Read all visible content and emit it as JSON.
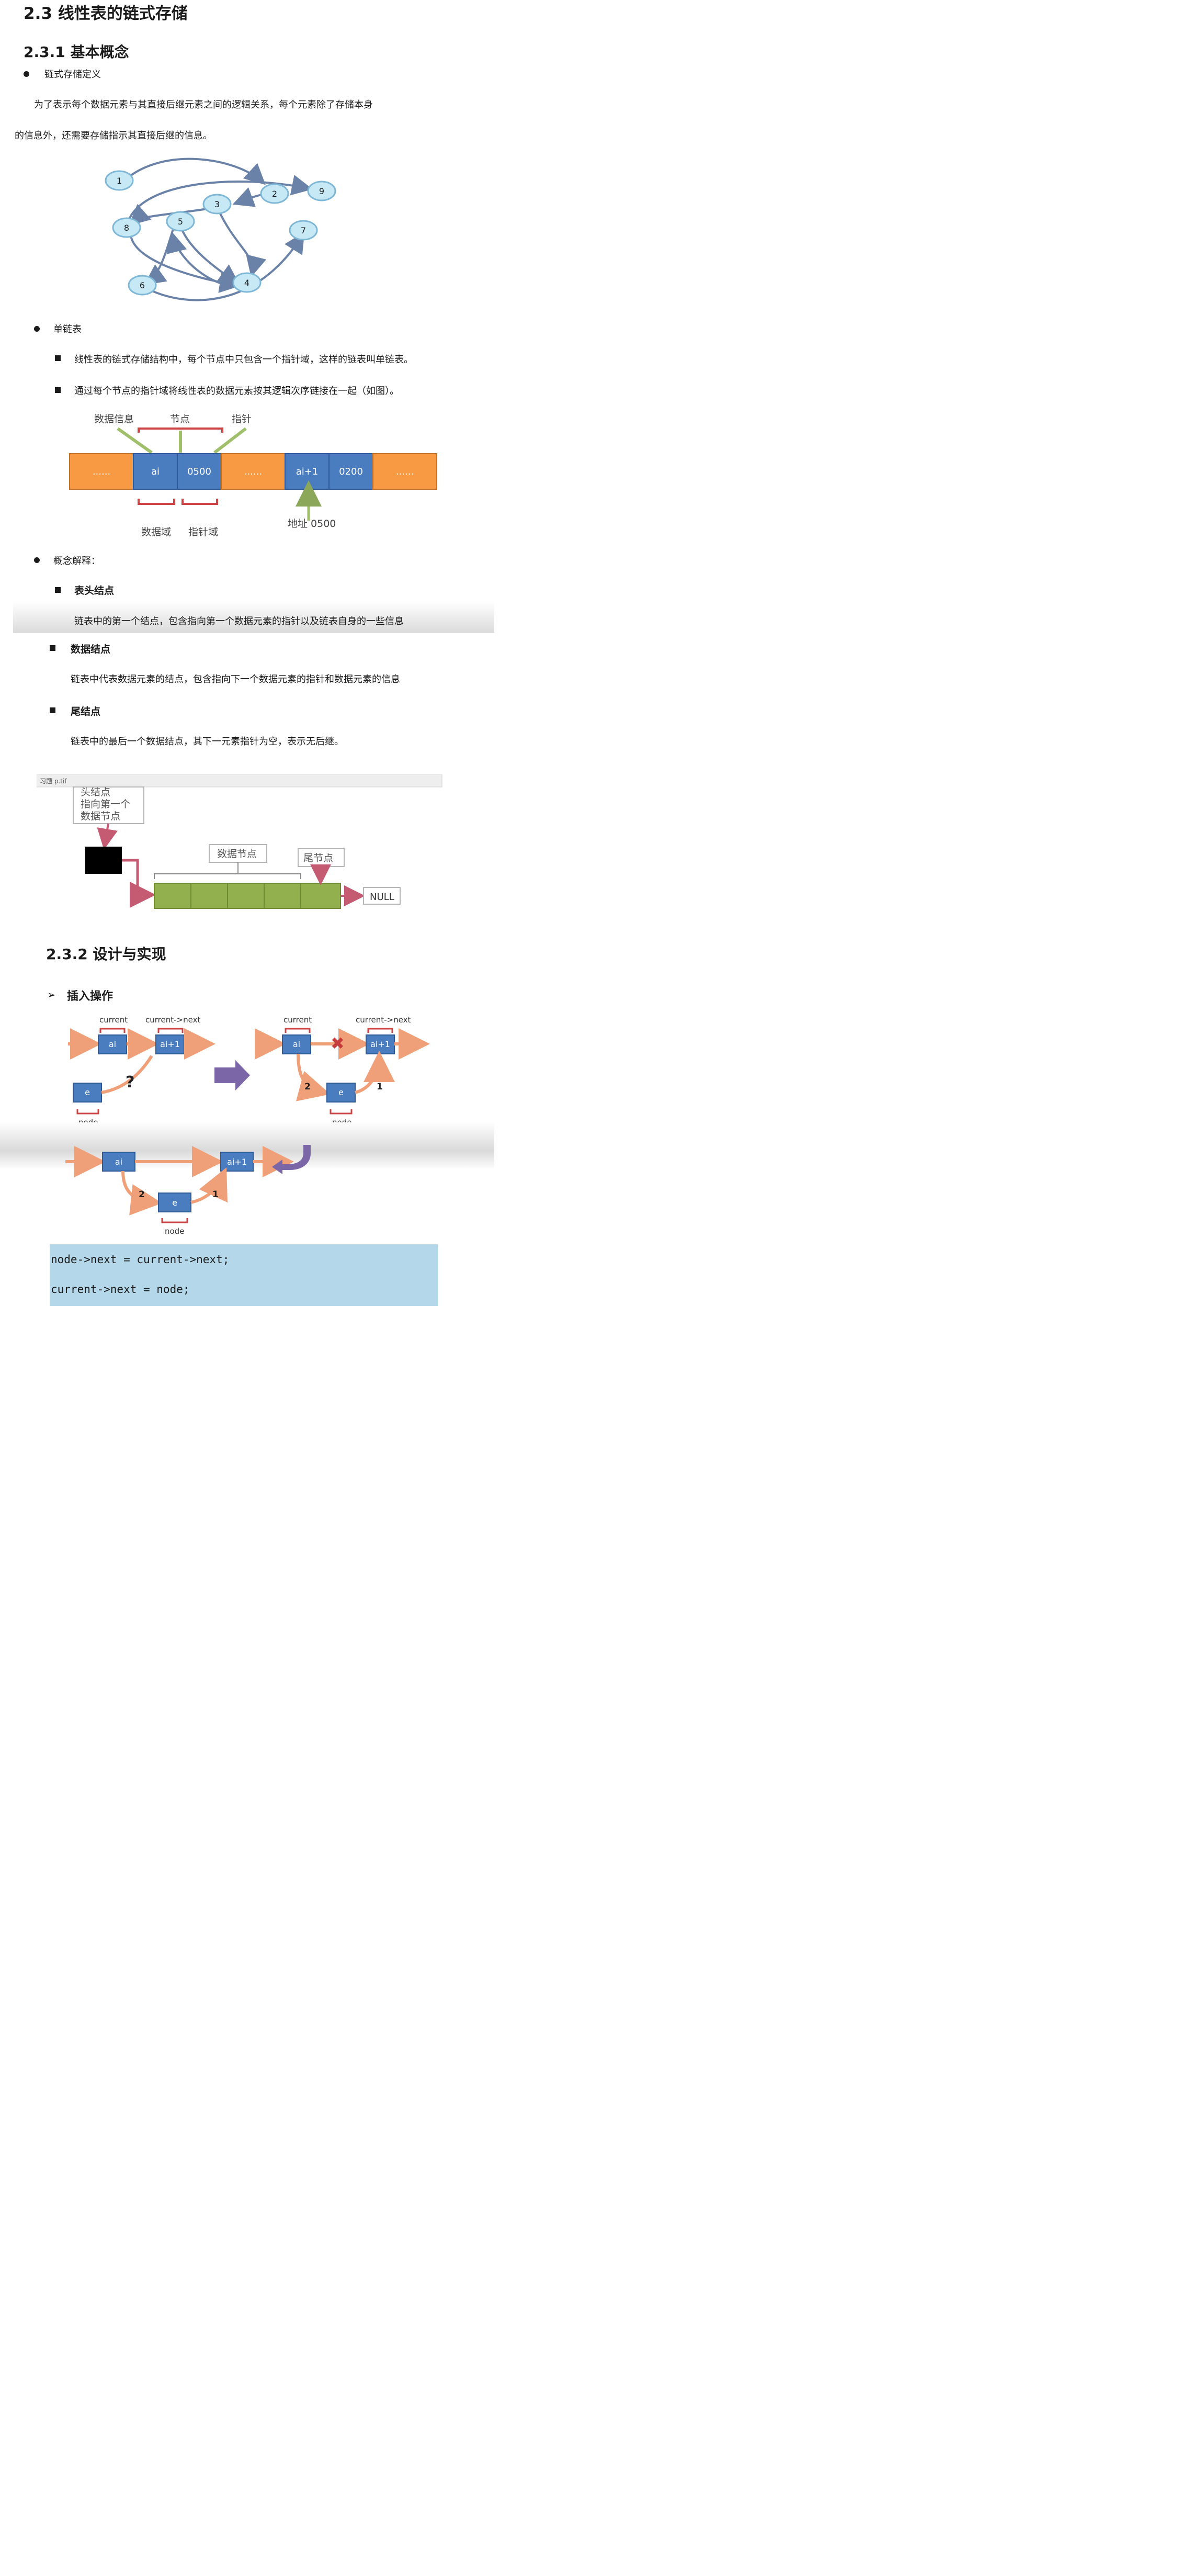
{
  "doc": {
    "title": "2.3 线性表的链式存储",
    "section1": "2.3.1 基本概念",
    "def_bullet": "链式存储定义",
    "def_para_line1": "为了表示每个数据元素与其直接后继元素之间的逻辑关系，每个元素除了存储本身",
    "def_para_line2": "的信息外，还需要存储指示其直接后继的信息。",
    "single_list_bullet": "单链表",
    "single_list_sub1": "线性表的链式存储结构中，每个节点中只包含一个指针域，这样的链表叫单链表。",
    "single_list_sub2": "通过每个节点的指针域将线性表的数据元素按其逻辑次序链接在一起（如图）。",
    "concept_bullet": "概念解释：",
    "head_node_title": "表头结点",
    "head_node_desc": "链表中的第一个结点，包含指向第一个数据元素的指针以及链表自身的一些信息",
    "data_node_title": "数据结点",
    "data_node_desc": "链表中代表数据元素的结点，包含指向下一个数据元素的指针和数据元素的信息",
    "tail_node_title": "尾结点",
    "tail_node_desc": "链表中的最后一个数据结点，其下一元素指针为空，表示无后继。",
    "section2": "2.3.2 设计与实现",
    "insert_bullet": "插入操作",
    "code_line1": "node->next = current->next;",
    "code_line2": "current->next = node;"
  },
  "graph": {
    "nodes": [
      "1",
      "2",
      "3",
      "4",
      "5",
      "6",
      "7",
      "8",
      "9"
    ]
  },
  "storage_fig": {
    "label_data_info": "数据信息",
    "label_node": "节点",
    "label_pointer": "指针",
    "cell_dots": "......",
    "cell_ai": "ai",
    "cell_ptr1": "0500",
    "cell_ai1": "ai+1",
    "cell_ptr2": "0200",
    "label_data_field": "数据域",
    "label_pointer_field": "指针域",
    "label_address": "地址 0500"
  },
  "list_fig": {
    "tab_label": "习题 p.tif",
    "head_label_1": "头结点",
    "head_label_2": "指向第一个",
    "head_label_3": "数据节点",
    "data_nodes_label": "数据节点",
    "tail_label": "尾节点",
    "null_label": "NULL"
  },
  "insert_fig": {
    "current": "current",
    "current_next": "current->next",
    "ai": "ai",
    "ai1": "ai+1",
    "e": "e",
    "node": "node",
    "question": "?",
    "step1": "1",
    "step2": "2"
  },
  "colors": {
    "orange": "#f79a43",
    "blue": "#4a7cc0",
    "green": "#93b04e",
    "code_bg": "#b4d8ea",
    "graph_node": "#c7e8f5",
    "arrow_purple": "#7b66a8"
  }
}
